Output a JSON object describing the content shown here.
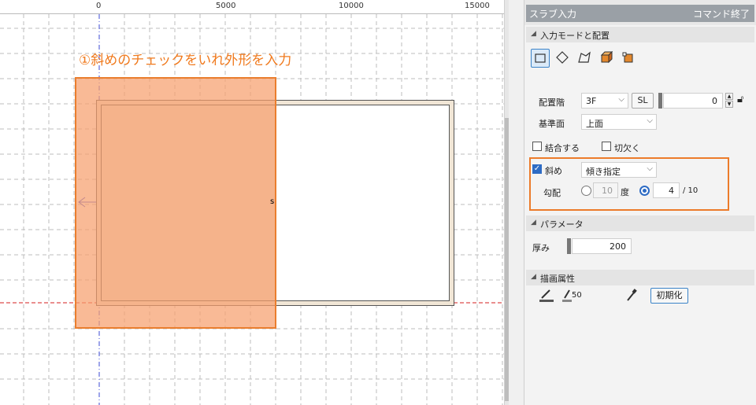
{
  "ruler": {
    "labels": [
      "0",
      "5000",
      "10000",
      "15000"
    ]
  },
  "canvas": {
    "annotation": "①斜めのチェックをいれ外形を入力",
    "cursor_mark": "s"
  },
  "panel": {
    "title": "スラブ入力",
    "command_end": "コマンド終了",
    "sections": {
      "input_mode": "入力モードと配置",
      "parameters": "パラメータ",
      "drawing_attributes": "描画属性"
    },
    "tools": [
      "rectangle-tool-icon",
      "polygon-tool-icon",
      "free-shape-tool-icon",
      "box-tool-icon",
      "solid-tool-icon"
    ],
    "floor": {
      "label": "配置階",
      "value": "3F",
      "sl_button": "SL",
      "offset": "0"
    },
    "base_surface": {
      "label": "基準面",
      "value": "上面"
    },
    "join": {
      "label": "結合する",
      "checked": false
    },
    "cutout": {
      "label": "切欠く",
      "checked": false
    },
    "slope": {
      "label": "斜め",
      "checked": true,
      "mode": "傾き指定"
    },
    "gradient": {
      "label": "勾配",
      "degree_value": "10",
      "degree_unit": "度",
      "ratio_value": "4",
      "ratio_suffix": "/ 10"
    },
    "thickness": {
      "label": "厚み",
      "value": "200"
    },
    "reset_button": "初期化",
    "line_width_value": "50",
    "colors": {
      "accent": "#ec7b2a",
      "selection": "#f7a06e",
      "check": "#2d6bc4"
    }
  }
}
